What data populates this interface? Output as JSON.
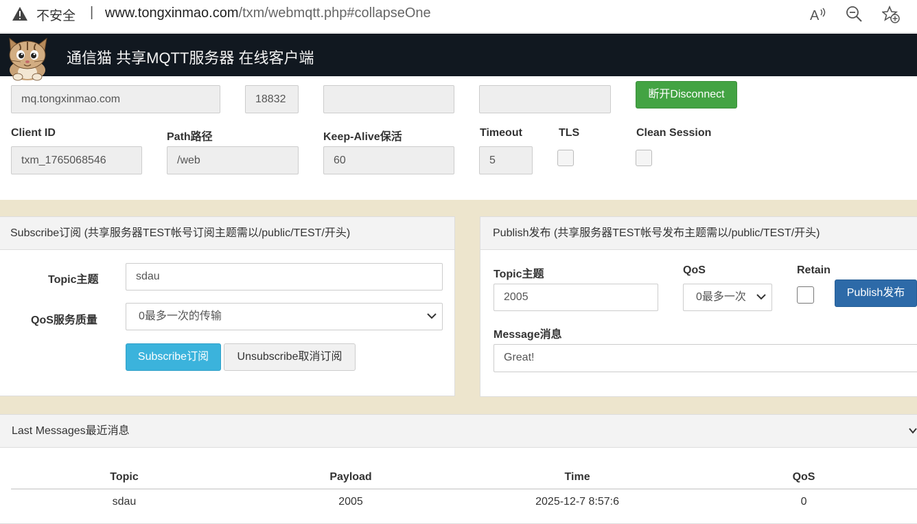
{
  "browser": {
    "insecure_label": "不安全",
    "separator": "|",
    "url_host": "www.tongxinmao.com",
    "url_path": "/txm/webmqtt.php#collapseOne",
    "icons": [
      "warning-icon",
      "read-aloud-icon",
      "zoom-out-icon",
      "add-favorite-icon"
    ]
  },
  "navbar": {
    "brand": "通信猫 共享MQTT服务器 在线客户端"
  },
  "connection": {
    "host_value": "mq.tongxinmao.com",
    "port_value": "18832",
    "username_value": "",
    "password_value": "",
    "disconnect_label": "断开Disconnect",
    "client_id_label": "Client ID",
    "client_id_value": "txm_1765068546",
    "path_label": "Path路径",
    "path_value": "/web",
    "keepalive_label": "Keep-Alive保活",
    "keepalive_value": "60",
    "timeout_label": "Timeout",
    "timeout_value": "5",
    "tls_label": "TLS",
    "clean_session_label": "Clean Session"
  },
  "subscribe": {
    "header": "Subscribe订阅 (共享服务器TEST帐号订阅主题需以/public/TEST/开头)",
    "topic_label": "Topic主题",
    "topic_value": "sdau",
    "qos_label": "QoS服务质量",
    "qos_value": "0最多一次的传输",
    "subscribe_label": "Subscribe订阅",
    "unsubscribe_label": "Unsubscribe取消订阅"
  },
  "publish": {
    "header": "Publish发布 (共享服务器TEST帐号发布主题需以/public/TEST/开头)",
    "topic_label": "Topic主题",
    "topic_value": "2005",
    "qos_label": "QoS",
    "qos_value": "0最多一次",
    "retain_label": "Retain",
    "publish_label": "Publish发布",
    "message_label": "Message消息",
    "message_value": "Great!"
  },
  "messages": {
    "header": "Last Messages最近消息",
    "columns": [
      "Topic",
      "Payload",
      "Time",
      "QoS"
    ],
    "rows": [
      [
        "sdau",
        "2005",
        "2025-12-7 8:57:6",
        "0"
      ]
    ]
  },
  "colors": {
    "navbar": "#111820",
    "beige": "#ede5cd",
    "green_button": "#43a343",
    "blue_button": "#3bb3dc",
    "primary_button": "#2d6aa8"
  }
}
